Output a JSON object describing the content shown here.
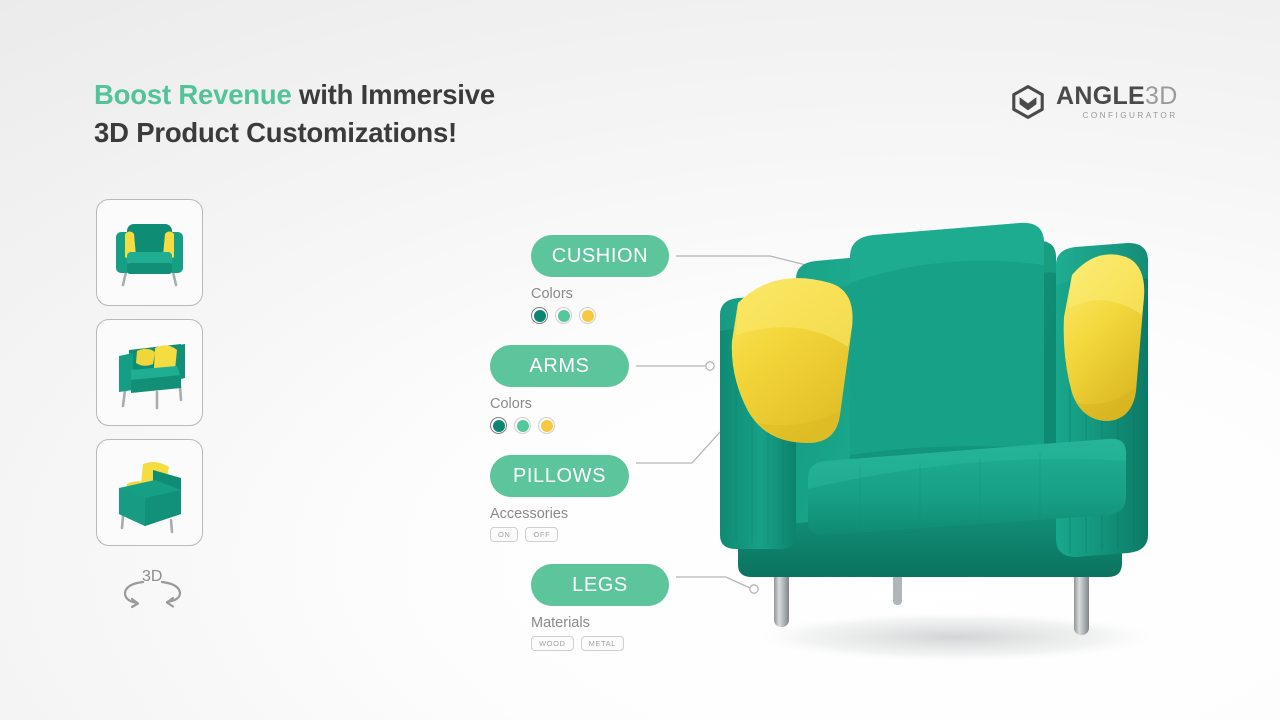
{
  "headline": {
    "accent_text": "Boost Revenue",
    "rest_line1": " with Immersive",
    "line2": "3D Product Customizations!"
  },
  "logo": {
    "word_main": "ANGLE",
    "word_thin": "3D",
    "subtitle": "CONFIGURATOR",
    "mark": "hexagon-logo-icon"
  },
  "viewer": {
    "rotate_label": "3D",
    "rotate_icon": "rotate-3d-icon",
    "thumbnails": [
      {
        "name": "thumbnail-front-view",
        "view": "front"
      },
      {
        "name": "thumbnail-angle-view",
        "view": "three-quarter-left"
      },
      {
        "name": "thumbnail-back-view",
        "view": "three-quarter-back"
      }
    ]
  },
  "hotspots": [
    {
      "id": "cushion",
      "label": "CUSHION",
      "option_title": "Colors",
      "control": "swatches",
      "swatches": [
        {
          "name": "swatch-dark-teal",
          "color": "#0d8573",
          "selected": true
        },
        {
          "name": "swatch-green",
          "color": "#56c79c",
          "selected": false
        },
        {
          "name": "swatch-yellow",
          "color": "#f6c93f",
          "selected": false
        }
      ]
    },
    {
      "id": "arms",
      "label": "ARMS",
      "option_title": "Colors",
      "control": "swatches",
      "swatches": [
        {
          "name": "swatch-dark-teal",
          "color": "#0d8573",
          "selected": true
        },
        {
          "name": "swatch-green",
          "color": "#56c79c",
          "selected": false
        },
        {
          "name": "swatch-yellow",
          "color": "#f6c93f",
          "selected": false
        }
      ]
    },
    {
      "id": "pillows",
      "label": "PILLOWS",
      "option_title": "Accessories",
      "control": "toggles",
      "toggles": [
        {
          "name": "toggle-on",
          "label": "ON"
        },
        {
          "name": "toggle-off",
          "label": "OFF"
        }
      ]
    },
    {
      "id": "legs",
      "label": "LEGS",
      "option_title": "Materials",
      "control": "toggles",
      "toggles": [
        {
          "name": "toggle-wood",
          "label": "WOOD"
        },
        {
          "name": "toggle-metal",
          "label": "METAL"
        }
      ]
    }
  ],
  "product": {
    "name": "armchair-3d-model",
    "colors": {
      "upholstery": "#15a085",
      "upholstery_dark": "#0e7f68",
      "upholstery_light": "#2ab396",
      "pillow": "#f5dc41",
      "pillow_shadow": "#e0c12d",
      "legs": "#b8bcbd"
    }
  },
  "theme": {
    "accent_green": "#5cc59c",
    "headline_accent": "#53c49a",
    "text_dark": "#3b3b3b",
    "text_muted": "#8a8a8a",
    "connector": "#b5b5b5",
    "background": "#ebebeb"
  }
}
